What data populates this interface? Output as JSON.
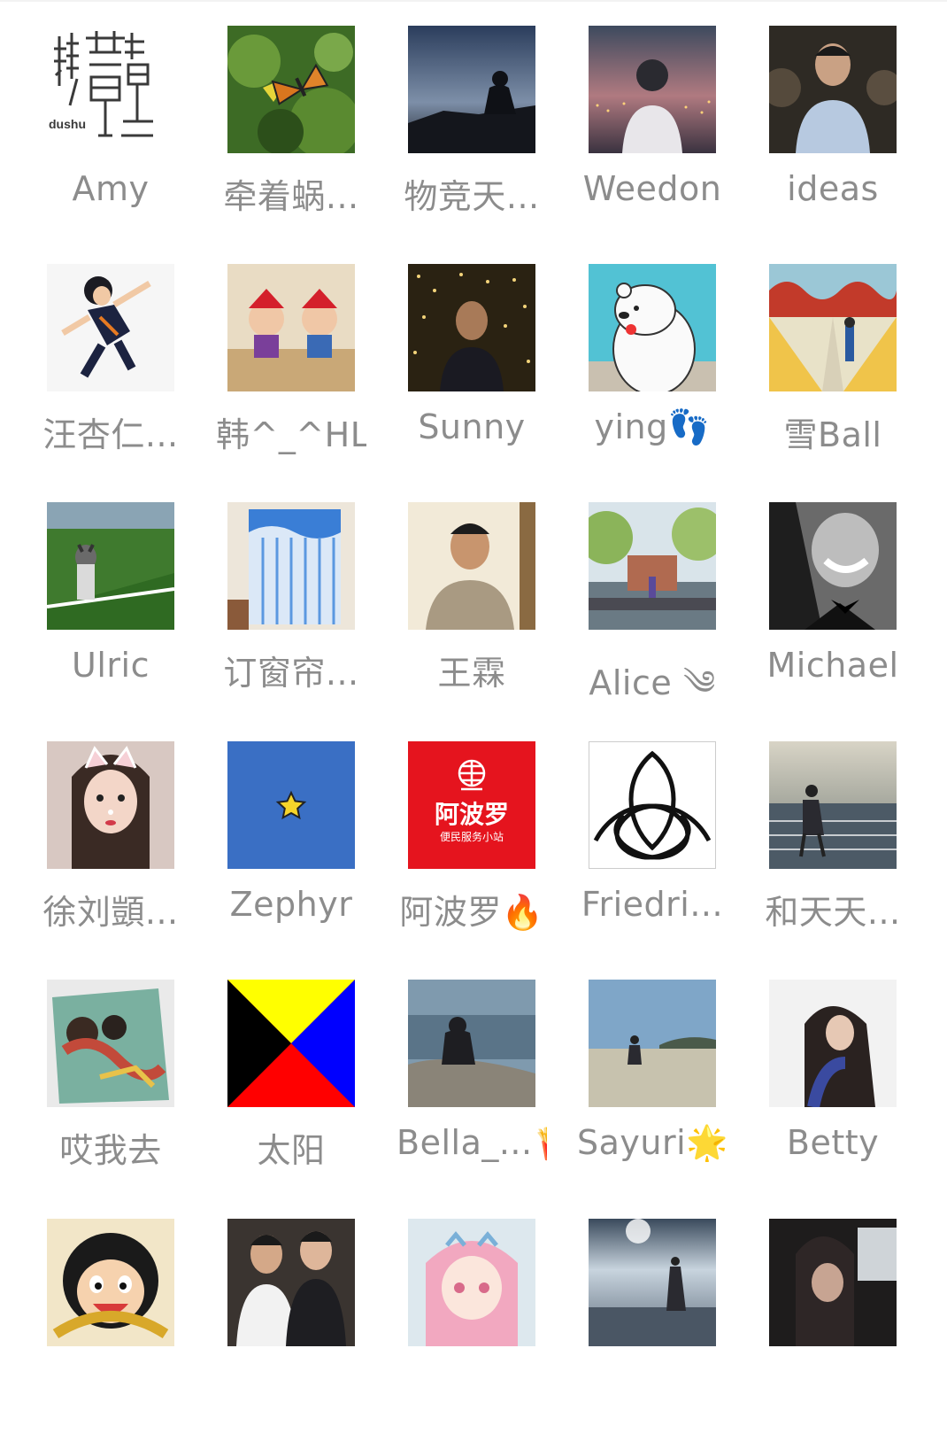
{
  "members": [
    {
      "name": "Amy",
      "avatar": "dushu-logo"
    },
    {
      "name": "牵着蜗...",
      "avatar": "butterfly-photo"
    },
    {
      "name": "物竞天...",
      "avatar": "silhouette-sunset-photo"
    },
    {
      "name": "Weedon",
      "avatar": "illustrated-boy-city-lights"
    },
    {
      "name": "ideas",
      "avatar": "man-portrait-photo"
    },
    {
      "name": "汪杏仁...",
      "avatar": "anime-volleyball-player"
    },
    {
      "name": "韩^_^HL",
      "avatar": "christmas-figurines-photo"
    },
    {
      "name": "Sunny",
      "avatar": "man-with-fairy-lights-photo"
    },
    {
      "name": "ying👣",
      "avatar": "cartoon-polar-bear"
    },
    {
      "name": "雪Ball",
      "avatar": "painted-street-scene"
    },
    {
      "name": "Ulric",
      "avatar": "husky-on-field-photo"
    },
    {
      "name": "订窗帘...",
      "avatar": "curtain-showroom-photo"
    },
    {
      "name": "王霖",
      "avatar": "man-selfie-photo"
    },
    {
      "name": "Alice ༄",
      "avatar": "woman-at-university-gate-photo"
    },
    {
      "name": "Michael",
      "avatar": "smiling-man-bw-photo"
    },
    {
      "name": "徐刘顗...",
      "avatar": "girl-cat-filter-selfie"
    },
    {
      "name": "Zephyr",
      "avatar": "blue-square-star"
    },
    {
      "name": "阿波罗🔥",
      "avatar": "apollo-store-logo"
    },
    {
      "name": "Friedri...",
      "avatar": "trinity-knot-logo"
    },
    {
      "name": "和天天...",
      "avatar": "person-at-seashore-photo"
    },
    {
      "name": "哎我去",
      "avatar": "painting-photo"
    },
    {
      "name": "太阳",
      "avatar": "yellow-blue-red-flag"
    },
    {
      "name": "Bella_...🍟",
      "avatar": "woman-on-rocks-by-sea-photo"
    },
    {
      "name": "Sayuri🌟",
      "avatar": "girl-on-beach-photo"
    },
    {
      "name": "Betty",
      "avatar": "woman-long-hair-photo"
    },
    {
      "name": "",
      "avatar": "cartoon-boy-straw-hat"
    },
    {
      "name": "",
      "avatar": "two-men-photo"
    },
    {
      "name": "",
      "avatar": "pink-hair-anime-girl"
    },
    {
      "name": "",
      "avatar": "woman-silhouette-beach-photo"
    },
    {
      "name": "",
      "avatar": "woman-in-car-photo"
    }
  ],
  "dushu_logo": {
    "small_text": "dushu"
  },
  "apollo_logo": {
    "title": "阿波罗",
    "subtitle": "便民服务小站"
  },
  "colors": {
    "name_text": "#8c8c8c",
    "apollo_red": "#e5141e",
    "zephyr_blue": "#3a6fc4"
  }
}
